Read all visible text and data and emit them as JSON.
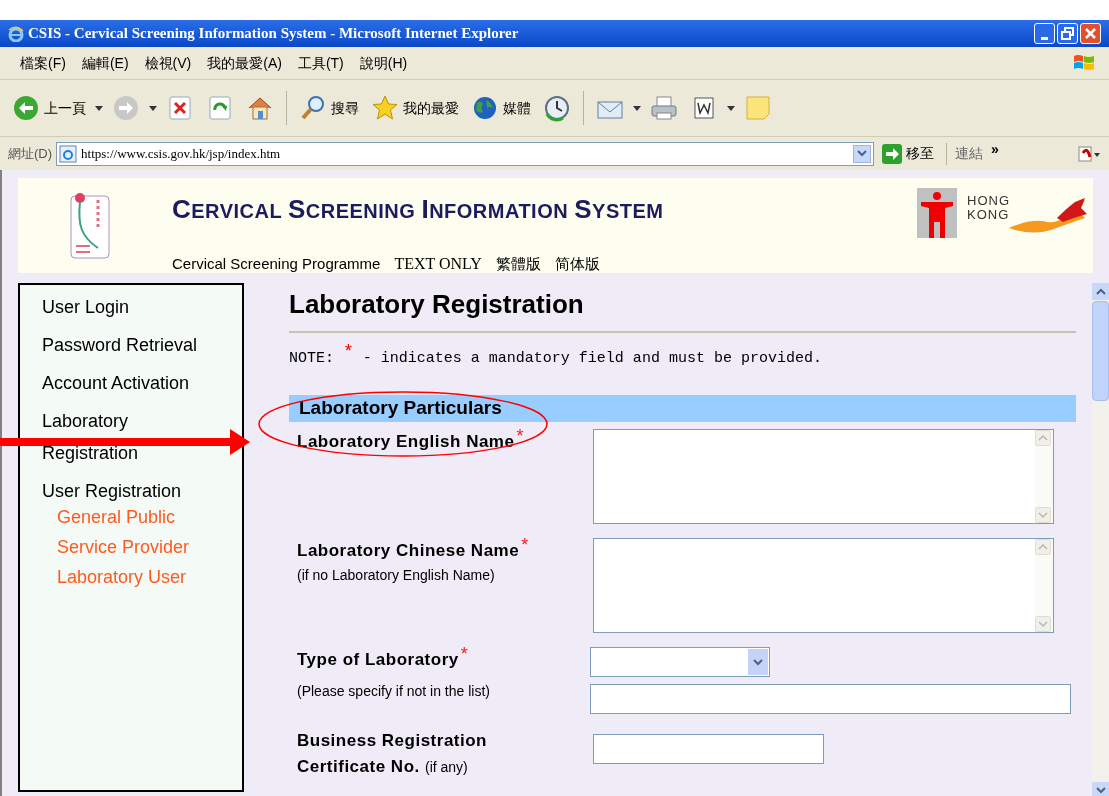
{
  "window": {
    "title": "CSIS - Cervical Screening Information System - Microsoft Internet Explorer"
  },
  "menu": [
    "檔案(F)",
    "編輯(E)",
    "檢視(V)",
    "我的最愛(A)",
    "工具(T)",
    "說明(H)"
  ],
  "toolbar": [
    {
      "kind": "back",
      "label": "上一頁"
    },
    {
      "kind": "forward"
    },
    {
      "kind": "stop"
    },
    {
      "kind": "refresh"
    },
    {
      "kind": "home"
    },
    {
      "kind": "separator"
    },
    {
      "kind": "search",
      "label": "搜尋"
    },
    {
      "kind": "favorites",
      "label": "我的最愛"
    },
    {
      "kind": "media",
      "label": "媒體"
    },
    {
      "kind": "history"
    },
    {
      "kind": "separator"
    },
    {
      "kind": "mail"
    },
    {
      "kind": "print"
    },
    {
      "kind": "edit"
    },
    {
      "kind": "note"
    }
  ],
  "address_bar": {
    "label": "網址(D)",
    "url": "https://www.csis.gov.hk/jsp/index.htm",
    "go": "移至",
    "links": "連結",
    "more": "»"
  },
  "header": {
    "title": "CERVICAL SCREENING INFORMATION SYSTEM",
    "logo_text": "HONG KONG",
    "links": [
      "Cervical Screening Programme",
      "TEXT ONLY",
      "繁體版",
      "简体版"
    ]
  },
  "sidebar": {
    "items": [
      {
        "kind": "main",
        "label": "User Login"
      },
      {
        "kind": "main",
        "label": "Password Retrieval"
      },
      {
        "kind": "main",
        "label": "Account Activation"
      },
      {
        "kind": "main",
        "label": "Laboratory Registration"
      },
      {
        "kind": "main",
        "label": "User Registration"
      },
      {
        "kind": "sub",
        "label": "General Public"
      },
      {
        "kind": "sub",
        "label": "Service Provider"
      },
      {
        "kind": "sub",
        "label": "Laboratory User"
      }
    ]
  },
  "content": {
    "heading": "Laboratory Registration",
    "note": {
      "prefix": "NOTE:",
      "mark": "*",
      "text": "- indicates a mandatory field and must be provided."
    },
    "section": "Laboratory Particulars",
    "fields": [
      {
        "kind": "textarea",
        "label": "Laboratory English Name",
        "required": true
      },
      {
        "kind": "textarea",
        "label": "Laboratory Chinese Name",
        "required": true,
        "hint": "(if no Laboratory English Name)"
      },
      {
        "kind": "select_other",
        "label": "Type of Laboratory",
        "required": true,
        "hint": "(Please specify if not in the list)"
      },
      {
        "kind": "text",
        "label": "Business Registration Certificate No.",
        "required": false,
        "inline_hint": "(if any)"
      }
    ]
  }
}
